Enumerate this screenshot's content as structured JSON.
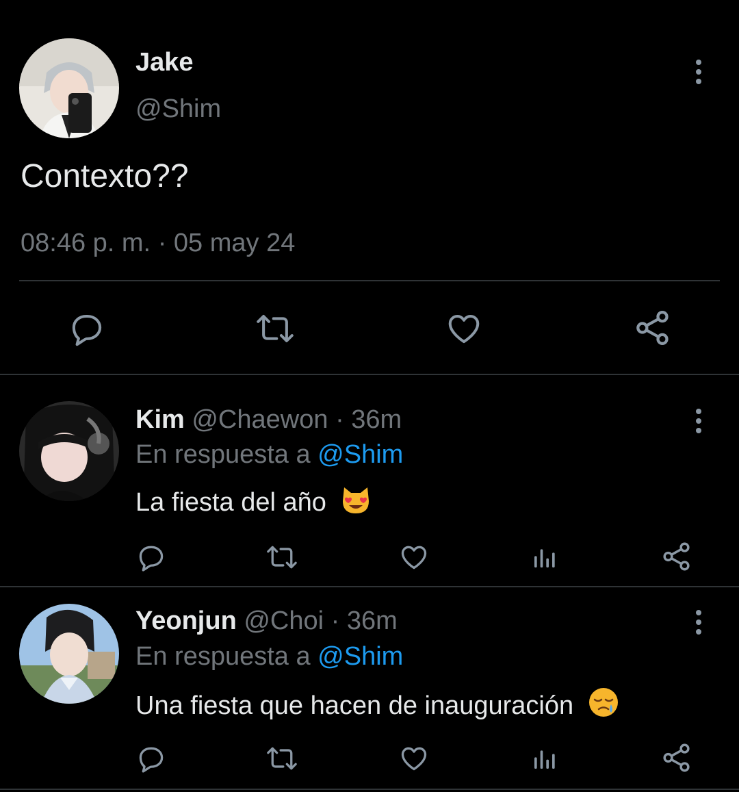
{
  "main_tweet": {
    "name": "Jake",
    "handle": "@Shim",
    "text": "Contexto??",
    "time": "08:46 p. m.",
    "separator": "·",
    "date": "05 may 24",
    "actions": [
      "reply-icon",
      "retweet-icon",
      "like-icon",
      "share-icon"
    ]
  },
  "replies": [
    {
      "name": "Kim",
      "handle": "@Chaewon",
      "separator": "·",
      "age": "36m",
      "reply_prefix": "En respuesta a",
      "reply_to": "@Shim",
      "text": "La fiesta del año",
      "emoji": "smiling-cat-heart-eyes",
      "actions": [
        "reply-icon",
        "retweet-icon",
        "like-icon",
        "views-icon",
        "share-icon"
      ]
    },
    {
      "name": "Yeonjun",
      "handle": "@Choi",
      "separator": "·",
      "age": "36m",
      "reply_prefix": "En respuesta a",
      "reply_to": "@Shim",
      "text": "Una fiesta que hacen de inauguración",
      "emoji": "sleepy-face",
      "actions": [
        "reply-icon",
        "retweet-icon",
        "like-icon",
        "views-icon",
        "share-icon"
      ]
    }
  ],
  "colors": {
    "background": "#000000",
    "text": "#e7e9ea",
    "muted": "#71767b",
    "link": "#1d9bf0",
    "divider": "#2f3336"
  }
}
